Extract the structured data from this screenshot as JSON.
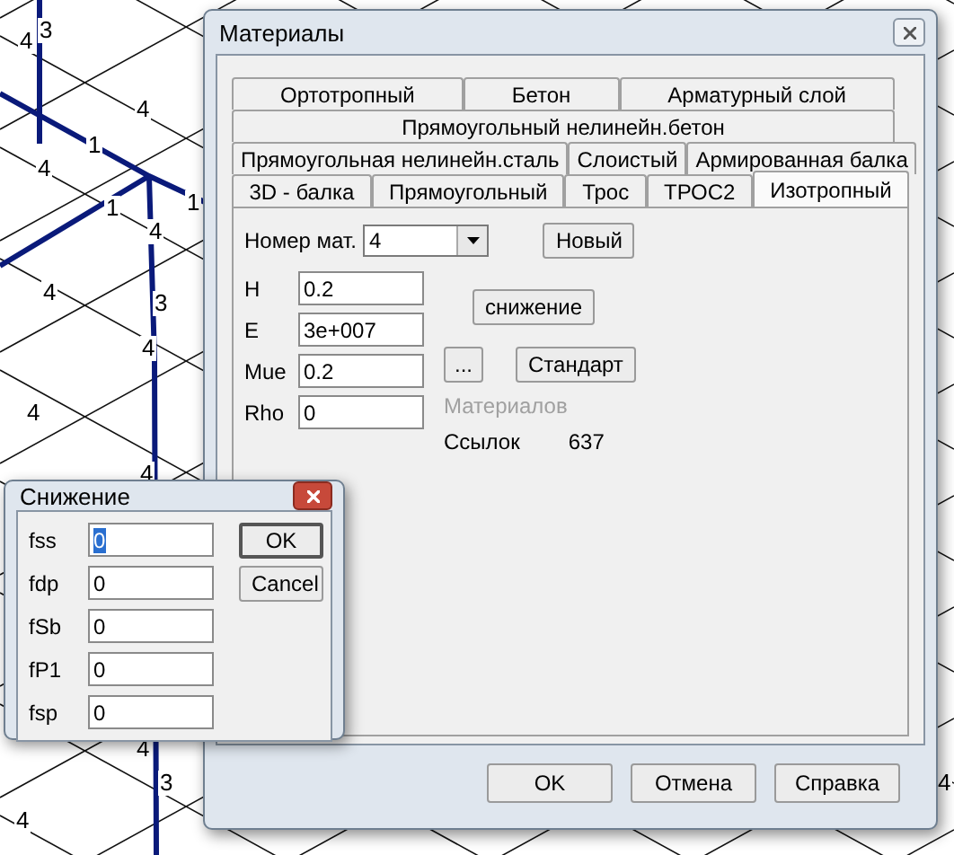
{
  "canvas": {
    "labels": [
      "4",
      "3",
      "4",
      "1",
      "4",
      "1",
      "1",
      "4",
      "4",
      "3",
      "4",
      "4",
      "4",
      "4",
      "3",
      "4",
      "4"
    ]
  },
  "materials_dialog": {
    "title": "Материалы",
    "tab_rows": [
      [
        {
          "label": "Ортотропный",
          "selected": false
        },
        {
          "label": "Бетон",
          "selected": false
        },
        {
          "label": "Арматурный слой",
          "selected": false
        }
      ],
      [
        {
          "label": "Прямоугольный нелинейн.бетон",
          "selected": false
        }
      ],
      [
        {
          "label": "Прямоугольная нелинейн.сталь",
          "selected": false
        },
        {
          "label": "Слоистый",
          "selected": false
        },
        {
          "label": "Армированная балка",
          "selected": false
        }
      ],
      [
        {
          "label": "3D - балка",
          "selected": false
        },
        {
          "label": "Прямоугольный",
          "selected": false
        },
        {
          "label": "Трос",
          "selected": false
        },
        {
          "label": "ТРОС2",
          "selected": false
        },
        {
          "label": "Изотропный",
          "selected": true
        }
      ]
    ],
    "material_number": {
      "label": "Номер мат.",
      "value": "4"
    },
    "new_button": "Новый",
    "fields": [
      {
        "label": "H",
        "value": "0.2"
      },
      {
        "label": "E",
        "value": "3e+007"
      },
      {
        "label": "Mue",
        "value": "0.2"
      },
      {
        "label": "Rho",
        "value": "0"
      }
    ],
    "reduction_button": "снижение",
    "ellipsis_button": "...",
    "standard_button": "Стандарт",
    "materials_label": {
      "text": "Материалов",
      "disabled": true
    },
    "links": {
      "label": "Ссылок",
      "value": "637"
    },
    "buttons": [
      "OK",
      "Отмена",
      "Справка"
    ]
  },
  "reduction_dialog": {
    "title": "Снижение",
    "fields": [
      {
        "label": "fss",
        "value": "0",
        "selected": true
      },
      {
        "label": "fdp",
        "value": "0",
        "selected": false
      },
      {
        "label": "fSb",
        "value": "0",
        "selected": false
      },
      {
        "label": "fP1",
        "value": "0",
        "selected": false
      },
      {
        "label": "fsp",
        "value": "0",
        "selected": false
      }
    ],
    "buttons": [
      {
        "label": "OK",
        "default": true
      },
      {
        "label": "Cancel",
        "default": false
      }
    ]
  }
}
